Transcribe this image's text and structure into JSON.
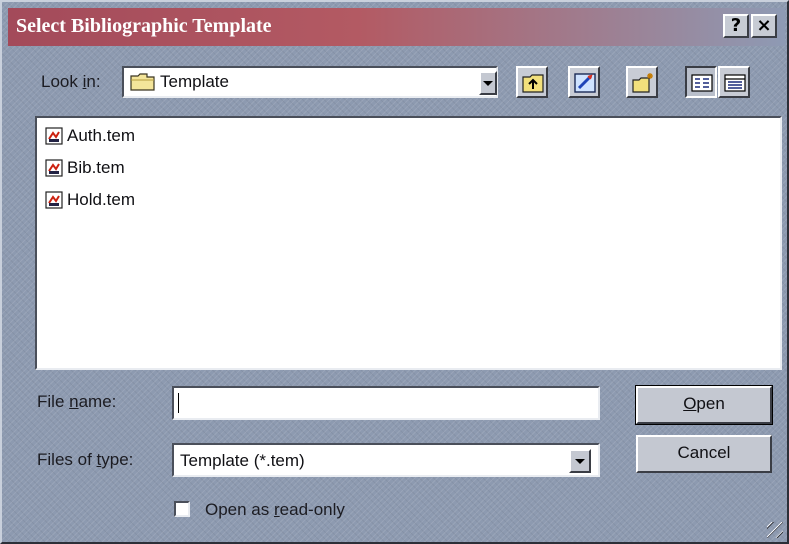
{
  "window": {
    "title": "Select Bibliographic Template",
    "help_button": "?",
    "close_button": "×"
  },
  "look_in": {
    "label_pre": "Look ",
    "label_accel": "i",
    "label_post": "n:",
    "value": "Template"
  },
  "toolbar": {
    "icons": [
      "up-one-level-icon",
      "desktop-icon",
      "create-new-folder-icon",
      "list-view-icon",
      "details-view-icon"
    ]
  },
  "files": [
    {
      "name": "Auth.tem",
      "icon": "template-file-icon"
    },
    {
      "name": "Bib.tem",
      "icon": "template-file-icon"
    },
    {
      "name": "Hold.tem",
      "icon": "template-file-icon"
    }
  ],
  "file_name": {
    "label_pre": "File ",
    "label_accel": "n",
    "label_post": "ame:",
    "value": ""
  },
  "files_of_type": {
    "label_pre": "Files of ",
    "label_accel": "t",
    "label_post": "ype:",
    "value": "Template (*.tem)"
  },
  "buttons": {
    "open_accel": "O",
    "open_rest": "pen",
    "cancel": "Cancel"
  },
  "read_only": {
    "label_pre": "Open as ",
    "label_accel": "r",
    "label_post": "ead-only",
    "checked": false
  }
}
